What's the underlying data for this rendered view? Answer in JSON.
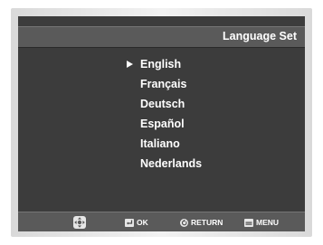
{
  "screen": {
    "title": "Language Set"
  },
  "languages": [
    {
      "label": "English",
      "selected": true
    },
    {
      "label": "Français",
      "selected": false
    },
    {
      "label": "Deutsch",
      "selected": false
    },
    {
      "label": "Español",
      "selected": false
    },
    {
      "label": "Italiano",
      "selected": false
    },
    {
      "label": "Nederlands",
      "selected": false
    }
  ],
  "footer": {
    "nav_icon": "directional-pad-icon",
    "ok_label": "OK",
    "return_label": "RETURN",
    "menu_label": "MENU"
  },
  "colors": {
    "background": "#3c3c3c",
    "bar": "#5a5a5a",
    "text": "#ffffff"
  }
}
